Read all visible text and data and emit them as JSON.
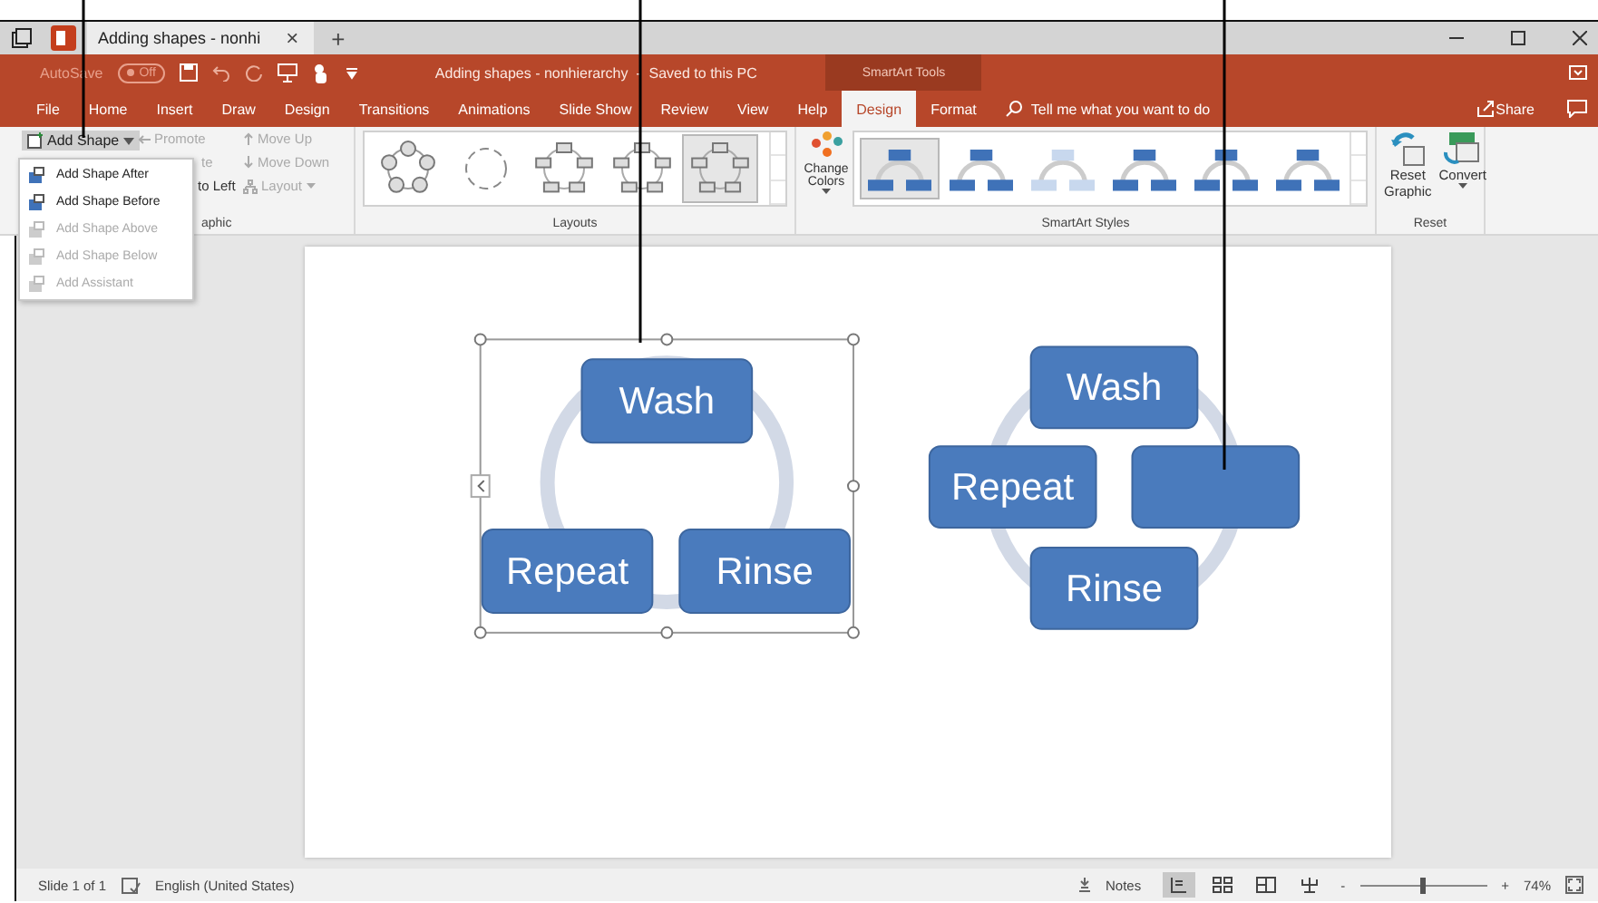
{
  "browser_tab": {
    "title": "Adding shapes - nonhi",
    "close": "×",
    "new_tab": "+"
  },
  "quick_access": {
    "autosave_label": "AutoSave",
    "autosave_on": false,
    "autosave_state": "Off"
  },
  "document_title": "Adding shapes - nonhierarchy  -  Saved to this PC",
  "contextual_header": "SmartArt Tools",
  "ribbon_tabs": [
    {
      "label": "File",
      "selected": false
    },
    {
      "label": "Home",
      "selected": false
    },
    {
      "label": "Insert",
      "selected": false
    },
    {
      "label": "Draw",
      "selected": false
    },
    {
      "label": "Design",
      "selected": false
    },
    {
      "label": "Transitions",
      "selected": false
    },
    {
      "label": "Animations",
      "selected": false
    },
    {
      "label": "Slide Show",
      "selected": false
    },
    {
      "label": "Review",
      "selected": false
    },
    {
      "label": "View",
      "selected": false
    },
    {
      "label": "Help",
      "selected": false
    },
    {
      "label": "Design",
      "selected": true
    },
    {
      "label": "Format",
      "selected": false
    }
  ],
  "tell_me": "Tell me what you want to do",
  "share": "Share",
  "create_graphic": {
    "add_shape": "Add Shape",
    "promote": "Promote",
    "demote": "te",
    "right_to_left": "to Left",
    "move_up": "Move Up",
    "move_down": "Move Down",
    "layout": "Layout",
    "group_label": "aphic"
  },
  "add_shape_menu": [
    {
      "label": "Add Shape After",
      "disabled": false
    },
    {
      "label": "Add Shape Before",
      "disabled": false
    },
    {
      "label": "Add Shape Above",
      "disabled": true
    },
    {
      "label": "Add Shape Below",
      "disabled": true
    },
    {
      "label": "Add Assistant",
      "disabled": true
    }
  ],
  "layouts": {
    "label": "Layouts",
    "thumbnails": [
      {
        "selected": false
      },
      {
        "selected": false
      },
      {
        "selected": false
      },
      {
        "selected": false
      },
      {
        "selected": true
      }
    ]
  },
  "smartart_styles": {
    "label": "SmartArt Styles",
    "change_colors": "Change Colors",
    "thumbnails": [
      {
        "selected": true
      },
      {
        "selected": false
      },
      {
        "selected": false
      },
      {
        "selected": false
      },
      {
        "selected": false
      },
      {
        "selected": false
      }
    ]
  },
  "reset": {
    "label": "Reset",
    "reset_graphic": "Reset Graphic",
    "convert": "Convert"
  },
  "slide": {
    "graphics": [
      {
        "selected": true,
        "shapes": [
          {
            "kind": "text",
            "text": "Wash"
          },
          {
            "kind": "text",
            "text": "Rinse"
          },
          {
            "kind": "text",
            "text": "Repeat"
          }
        ]
      },
      {
        "selected": false,
        "shapes": [
          {
            "kind": "text",
            "text": "Wash"
          },
          {
            "kind": "blank"
          },
          {
            "kind": "text",
            "text": "Rinse"
          },
          {
            "kind": "text",
            "text": "Repeat"
          }
        ]
      }
    ]
  },
  "status_bar": {
    "slide_count": "Slide 1 of 1",
    "language": "English (United States)",
    "notes": "Notes",
    "views": [
      {
        "selected": true
      },
      {
        "selected": false
      },
      {
        "selected": false
      },
      {
        "selected": false
      }
    ],
    "zoom_minus": "-",
    "zoom_plus": "+",
    "zoom": {
      "level": 0.5
    },
    "zoom_percent": "74%"
  }
}
